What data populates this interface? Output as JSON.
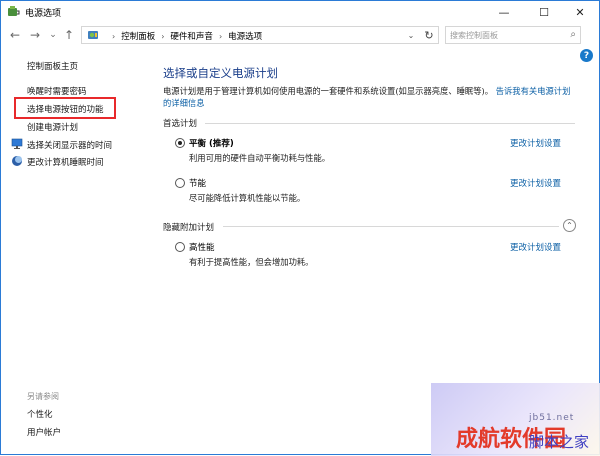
{
  "window": {
    "title": "电源选项",
    "controls": {
      "minimize": "—",
      "maximize": "☐",
      "close": "✕"
    }
  },
  "nav": {
    "back": "←",
    "forward": "→",
    "recent": "⌄",
    "up": "↑",
    "breadcrumbs": [
      "控制面板",
      "硬件和声音",
      "电源选项"
    ],
    "separator": "›",
    "dropdown": "⌄",
    "refresh": "↻",
    "search_placeholder": "搜索控制面板",
    "search_icon": "⌕"
  },
  "help": "?",
  "sidebar": {
    "home": "控制面板主页",
    "links": [
      "唤醒时需要密码",
      "选择电源按钮的功能",
      "创建电源计划",
      "选择关闭显示器的时间",
      "更改计算机睡眠时间"
    ],
    "see_also_label": "另请参阅",
    "see_also": [
      "个性化",
      "用户帐户"
    ]
  },
  "main": {
    "heading": "选择或自定义电源计划",
    "intro_text": "电源计划是用于管理计算机如何使用电源的一套硬件和系统设置(如显示器亮度、睡眠等)。",
    "intro_link": "告诉我有关电源计划的详细信息",
    "preferred_label": "首选计划",
    "hidden_label": "隐藏附加计划",
    "plans": [
      {
        "name": "平衡",
        "note": " (推荐)",
        "desc": "利用可用的硬件自动平衡功耗与性能。",
        "checked": true,
        "link": "更改计划设置"
      },
      {
        "name": "节能",
        "note": "",
        "desc": "尽可能降低计算机性能以节能。",
        "checked": false,
        "link": "更改计划设置"
      },
      {
        "name": "高性能",
        "note": "",
        "desc": "有利于提高性能，但会增加功耗。",
        "checked": false,
        "link": "更改计划设置"
      }
    ],
    "collapse_icon": "⌃"
  },
  "watermark": {
    "red": "成航软件园",
    "blue": "脚本之家",
    "small": "jb51.net"
  }
}
